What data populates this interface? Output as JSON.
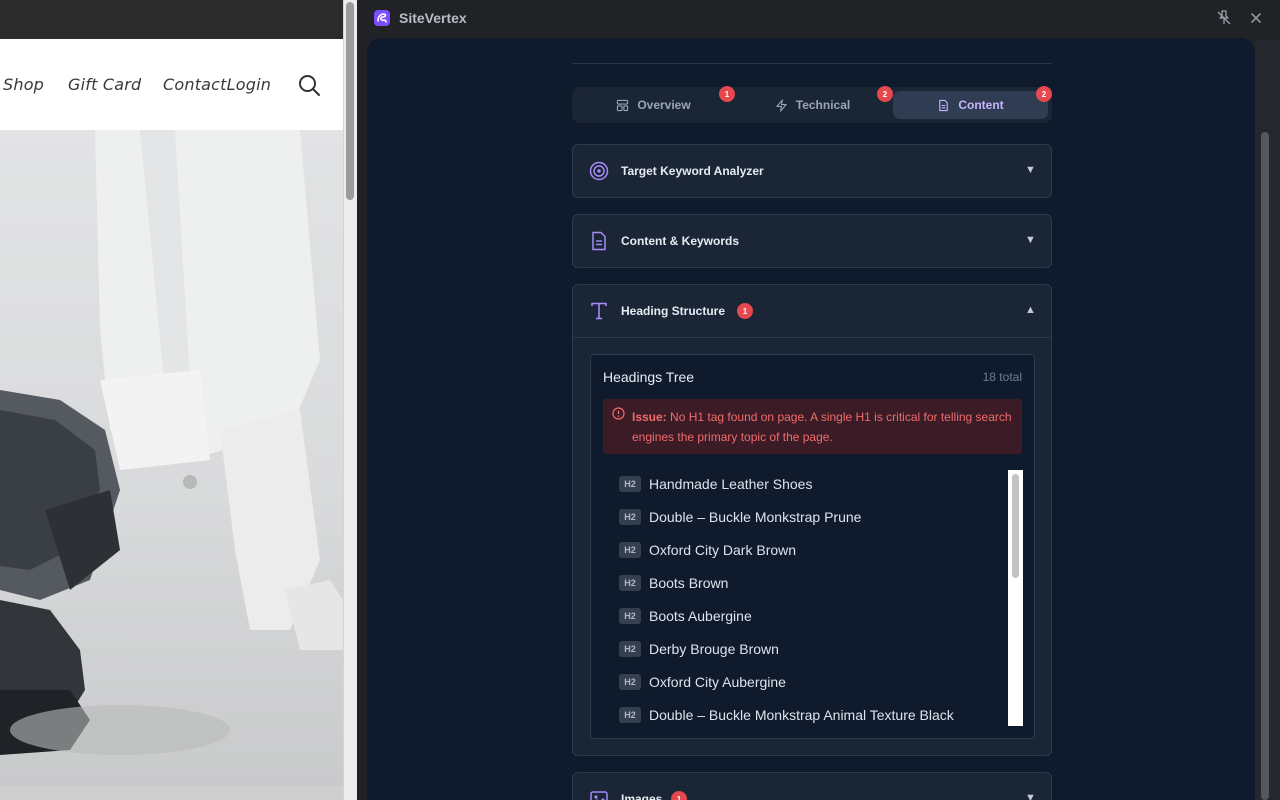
{
  "website": {
    "nav": {
      "shop": "Shop",
      "gift_card": "Gift Card",
      "contact_login": "ContactLogin"
    }
  },
  "app": {
    "title": "SiteVertex"
  },
  "tabs": [
    {
      "label": "Overview",
      "badge": "1",
      "active": false
    },
    {
      "label": "Technical",
      "badge": "2",
      "active": false
    },
    {
      "label": "Content",
      "badge": "2",
      "active": true
    }
  ],
  "sections": {
    "target_keyword": {
      "title": "Target Keyword Analyzer",
      "caret": "▼"
    },
    "content_keywords": {
      "title": "Content & Keywords",
      "caret": "▼"
    },
    "heading_structure": {
      "title": "Heading Structure",
      "badge": "1",
      "caret": "▲"
    },
    "images": {
      "title": "Images",
      "badge": "1",
      "caret": "▼"
    }
  },
  "headings_tree": {
    "title": "Headings Tree",
    "total": "18 total",
    "issue_label": "Issue:",
    "issue_text": "No H1 tag found on page. A single H1 is critical for telling search engines the primary topic of the page.",
    "items": [
      {
        "tag": "H2",
        "text": "Handmade Leather Shoes"
      },
      {
        "tag": "H2",
        "text": "Double – Buckle Monkstrap Prune"
      },
      {
        "tag": "H2",
        "text": "Oxford City Dark Brown"
      },
      {
        "tag": "H2",
        "text": "Boots Brown"
      },
      {
        "tag": "H2",
        "text": "Boots Aubergine"
      },
      {
        "tag": "H2",
        "text": "Derby Brouge Brown"
      },
      {
        "tag": "H2",
        "text": "Oxford City Aubergine"
      },
      {
        "tag": "H2",
        "text": "Double – Buckle Monkstrap Animal Texture Black"
      }
    ]
  },
  "colors": {
    "accent": "#c4b5fd",
    "badge": "#e5484d",
    "panel_bg": "#0f1a2c",
    "issue_text": "#f06b6b"
  }
}
